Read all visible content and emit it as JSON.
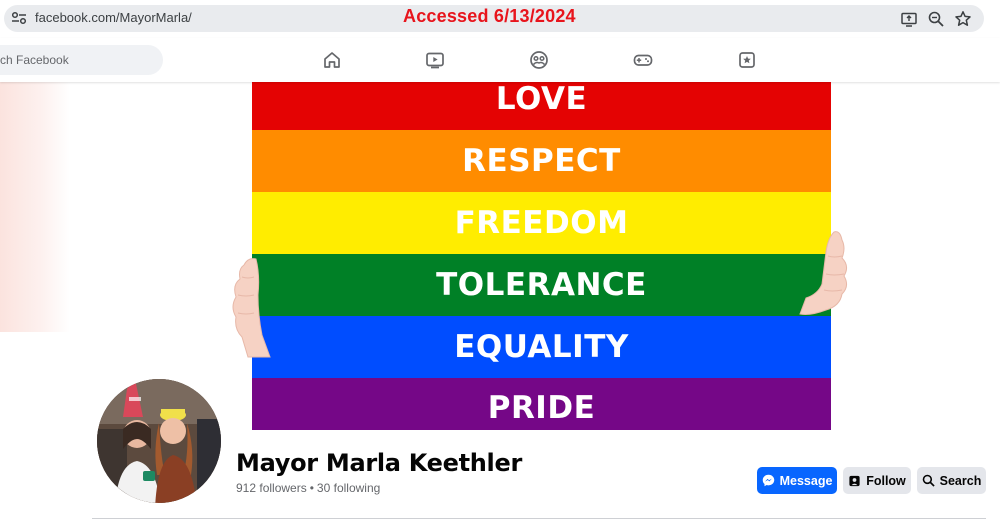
{
  "browser": {
    "url": "facebook.com/MayorMarla/",
    "overlay_text": "Accessed 6/13/2024",
    "overlay_color": "#e8141c",
    "icons": [
      "site-settings-icon",
      "cast-icon",
      "zoom-icon",
      "bookmark-star-icon"
    ]
  },
  "fb_nav": {
    "search_placeholder": "ch Facebook",
    "icons": [
      "home-icon",
      "video-icon",
      "groups-icon",
      "gaming-icon",
      "pages-icon"
    ]
  },
  "cover": {
    "stripes": [
      {
        "label": "LOVE",
        "color": "#e40303"
      },
      {
        "label": "RESPECT",
        "color": "#ff8c00"
      },
      {
        "label": "FREEDOM",
        "color": "#ffed00"
      },
      {
        "label": "TOLERANCE",
        "color": "#008026"
      },
      {
        "label": "EQUALITY",
        "color": "#004dff"
      },
      {
        "label": "PRIDE",
        "color": "#750787"
      }
    ]
  },
  "profile": {
    "name": "Mayor Marla Keethler",
    "followers": "912 followers",
    "following": "30 following",
    "separator": "•"
  },
  "actions": {
    "message_label": "Message",
    "follow_label": "Follow",
    "search_label": "Search",
    "accent": "#0866ff"
  }
}
